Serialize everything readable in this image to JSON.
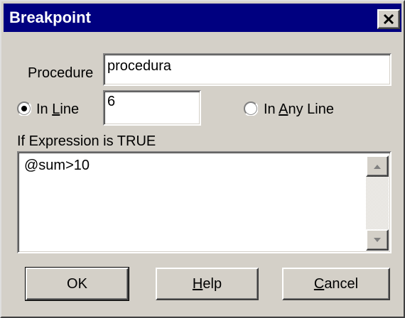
{
  "window": {
    "title": "Breakpoint",
    "close_icon": "close-x-icon"
  },
  "procedure": {
    "label": "Procedure",
    "value": "procedura"
  },
  "in_line": {
    "label_before": "In ",
    "label_mnemonic": "L",
    "label_after": "ine",
    "selected": true,
    "value": "6"
  },
  "in_any_line": {
    "label_before": "In ",
    "label_mnemonic": "A",
    "label_after": "ny Line",
    "selected": false
  },
  "expression": {
    "label": "If Expression is TRUE",
    "value": "@sum>10"
  },
  "buttons": {
    "ok": "OK",
    "help_mnemonic": "H",
    "help_rest": "elp",
    "cancel_mnemonic": "C",
    "cancel_rest": "ancel"
  },
  "colors": {
    "title_bar": "#000080",
    "face": "#d4d0c8"
  }
}
